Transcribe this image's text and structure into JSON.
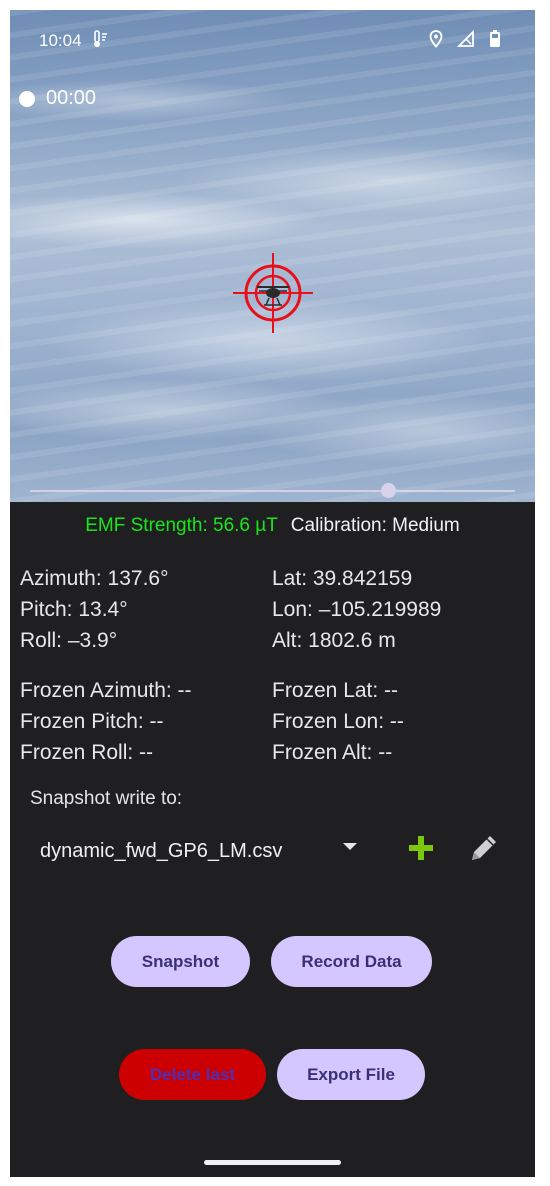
{
  "status_bar": {
    "time": "10:04",
    "left_icon": "thermometer-icon",
    "right_icons": [
      "location-icon",
      "signal-icon",
      "battery-icon"
    ]
  },
  "recording": {
    "timer": "00:00"
  },
  "zoom": {
    "level": 0.74
  },
  "readings": {
    "emf_strength": "EMF Strength: 56.6 µT",
    "calibration": "Calibration: Medium",
    "azimuth": "Azimuth: 137.6°",
    "pitch": "Pitch: 13.4°",
    "roll": "Roll: –3.9°",
    "lat": "Lat: 39.842159",
    "lon": "Lon: –105.219989",
    "alt": "Alt: 1802.6 m",
    "frozen_azimuth": "Frozen Azimuth: --",
    "frozen_pitch": "Frozen Pitch: --",
    "frozen_roll": "Frozen Roll: --",
    "frozen_lat": "Frozen Lat: --",
    "frozen_lon": "Frozen Lon: --",
    "frozen_alt": "Frozen Alt: --"
  },
  "snapshot": {
    "label": "Snapshot write to:",
    "selected_file": "dynamic_fwd_GP6_LM.csv"
  },
  "buttons": {
    "snapshot": "Snapshot",
    "record_data": "Record Data",
    "delete_last": "Delete last",
    "export_file": "Export File"
  },
  "colors": {
    "emf_green": "#19e619",
    "button_bg": "#d4c7ff",
    "delete_bg": "#cc0000",
    "reticle_red": "#e8101a",
    "panel_bg": "#1f1f22"
  }
}
